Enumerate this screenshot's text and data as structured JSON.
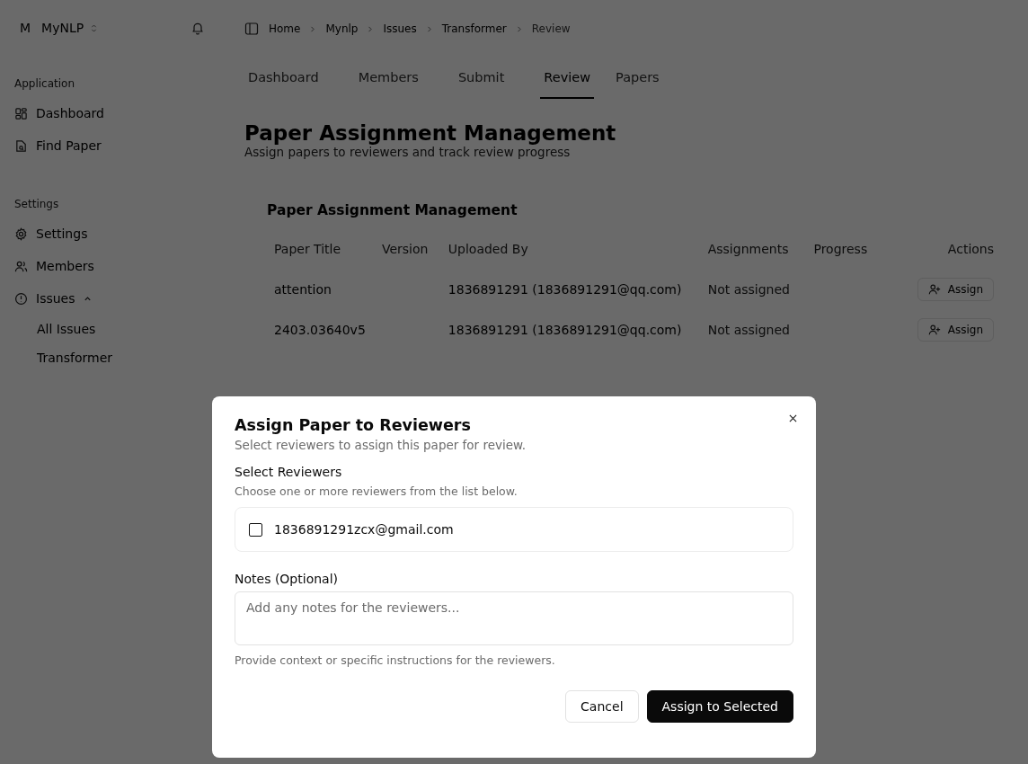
{
  "workspace": {
    "initial": "M",
    "name": "MyNLP"
  },
  "sidebar": {
    "groups": [
      {
        "label": "Application",
        "items": [
          {
            "label": "Dashboard"
          },
          {
            "label": "Find Paper"
          }
        ]
      },
      {
        "label": "Settings",
        "items": [
          {
            "label": "Settings"
          },
          {
            "label": "Members"
          },
          {
            "label": "Issues",
            "expanded": true,
            "children": [
              {
                "label": "All Issues"
              },
              {
                "label": "Transformer"
              }
            ]
          }
        ]
      }
    ]
  },
  "breadcrumb": [
    {
      "label": "Home",
      "current": false
    },
    {
      "label": "Mynlp",
      "current": false
    },
    {
      "label": "Issues",
      "current": false
    },
    {
      "label": "Transformer",
      "current": false
    },
    {
      "label": "Review",
      "current": true
    }
  ],
  "tabs": [
    {
      "label": "Dashboard",
      "selected": false
    },
    {
      "label": "Members",
      "selected": false
    },
    {
      "label": "Submit",
      "selected": false
    },
    {
      "label": "Review",
      "selected": true
    },
    {
      "label": "Papers",
      "selected": false
    }
  ],
  "page": {
    "title": "Paper Assignment Management",
    "subtitle": "Assign papers to reviewers and track review progress"
  },
  "card": {
    "title": "Paper Assignment Management",
    "columns": [
      "Paper Title",
      "Version",
      "Uploaded By",
      "Assignments",
      "Progress",
      "Actions"
    ],
    "rows": [
      {
        "title": "attention",
        "uploaded_by": "1836891291 (1836891291@qq.com)",
        "assignments": "Not assigned",
        "action": "Assign"
      },
      {
        "title": "2403.03640v5",
        "uploaded_by": "1836891291 (1836891291@qq.com)",
        "assignments": "Not assigned",
        "action": "Assign"
      }
    ]
  },
  "dialog": {
    "title": "Assign Paper to Reviewers",
    "description": "Select reviewers to assign this paper for review.",
    "reviewers_label": "Select Reviewers",
    "reviewers_hint": "Choose one or more reviewers from the list below.",
    "reviewers": [
      {
        "email": "1836891291zcx@gmail.com",
        "checked": false
      }
    ],
    "notes_label": "Notes (Optional)",
    "notes_placeholder": "Add any notes for the reviewers...",
    "notes_hint": "Provide context or specific instructions for the reviewers.",
    "buttons": [
      {
        "label": "Cancel",
        "kind": "secondary"
      },
      {
        "label": "Assign to Selected",
        "kind": "primary"
      }
    ]
  }
}
